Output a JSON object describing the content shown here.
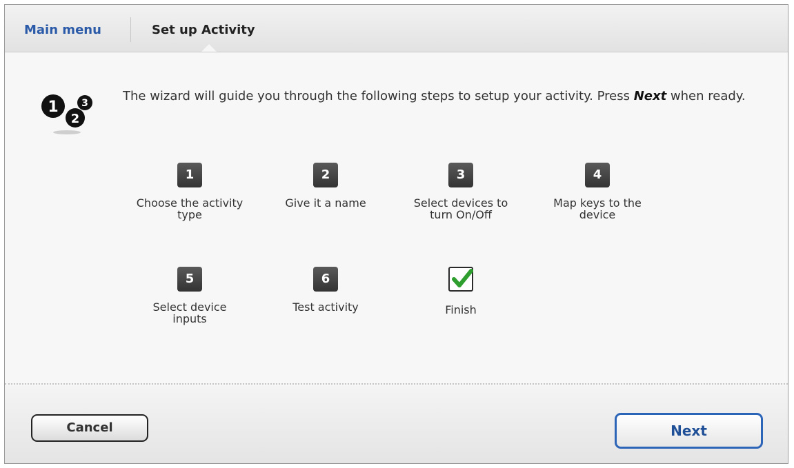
{
  "tabs": {
    "main_menu": "Main menu",
    "current": "Set up Activity"
  },
  "intro": {
    "text_before": "The wizard will guide you through the following steps to setup your activity. Press ",
    "emphasis": "Next",
    "text_after": " when ready."
  },
  "wizard_icon": {
    "name": "numbers-123-icon",
    "digits": [
      "1",
      "2",
      "3"
    ]
  },
  "steps": [
    {
      "number": "1",
      "label_line1": "Choose the activity",
      "label_line2": "type"
    },
    {
      "number": "2",
      "label_line1": "Give it a name",
      "label_line2": ""
    },
    {
      "number": "3",
      "label_line1": "Select devices to",
      "label_line2": "turn On/Off"
    },
    {
      "number": "4",
      "label_line1": "Map keys to the",
      "label_line2": "device"
    },
    {
      "number": "5",
      "label_line1": "Select device",
      "label_line2": "inputs"
    },
    {
      "number": "6",
      "label_line1": "Test activity",
      "label_line2": ""
    }
  ],
  "finish": {
    "label": "Finish",
    "icon": "checkmark-icon",
    "color": "#2e9e2e"
  },
  "buttons": {
    "cancel": "Cancel",
    "next": "Next"
  },
  "colors": {
    "link_blue": "#2b5aa8",
    "next_border": "#2c64b8",
    "step_badge": "#3a3a3a"
  }
}
